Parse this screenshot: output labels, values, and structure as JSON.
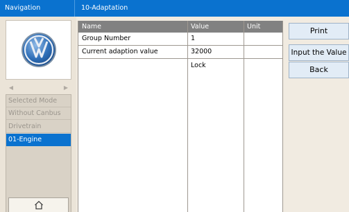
{
  "topbar": {
    "nav_label": "Navigation",
    "title": "10-Adaptation"
  },
  "sidebar": {
    "logo": "volkswagen-logo",
    "modes": [
      {
        "label": "Selected Mode",
        "selected": false
      },
      {
        "label": "Without Canbus",
        "selected": false
      },
      {
        "label": "Drivetrain",
        "selected": false
      },
      {
        "label": "01-Engine",
        "selected": true
      }
    ],
    "home_icon": "home-icon"
  },
  "table": {
    "headers": {
      "name": "Name",
      "value": "Value",
      "unit": "Unit"
    },
    "rows": [
      {
        "name": "Group Number",
        "value": "1",
        "unit": ""
      },
      {
        "name": "Current adaption value",
        "value": "32000",
        "unit": ""
      },
      {
        "name": "",
        "value": "Lock",
        "unit": ""
      }
    ]
  },
  "buttons": {
    "print": "Print",
    "input_value": "Input the Value",
    "back": "Back"
  },
  "colors": {
    "accent": "#0a72cf",
    "header_gray": "#818181",
    "background": "#f1ebe1"
  }
}
